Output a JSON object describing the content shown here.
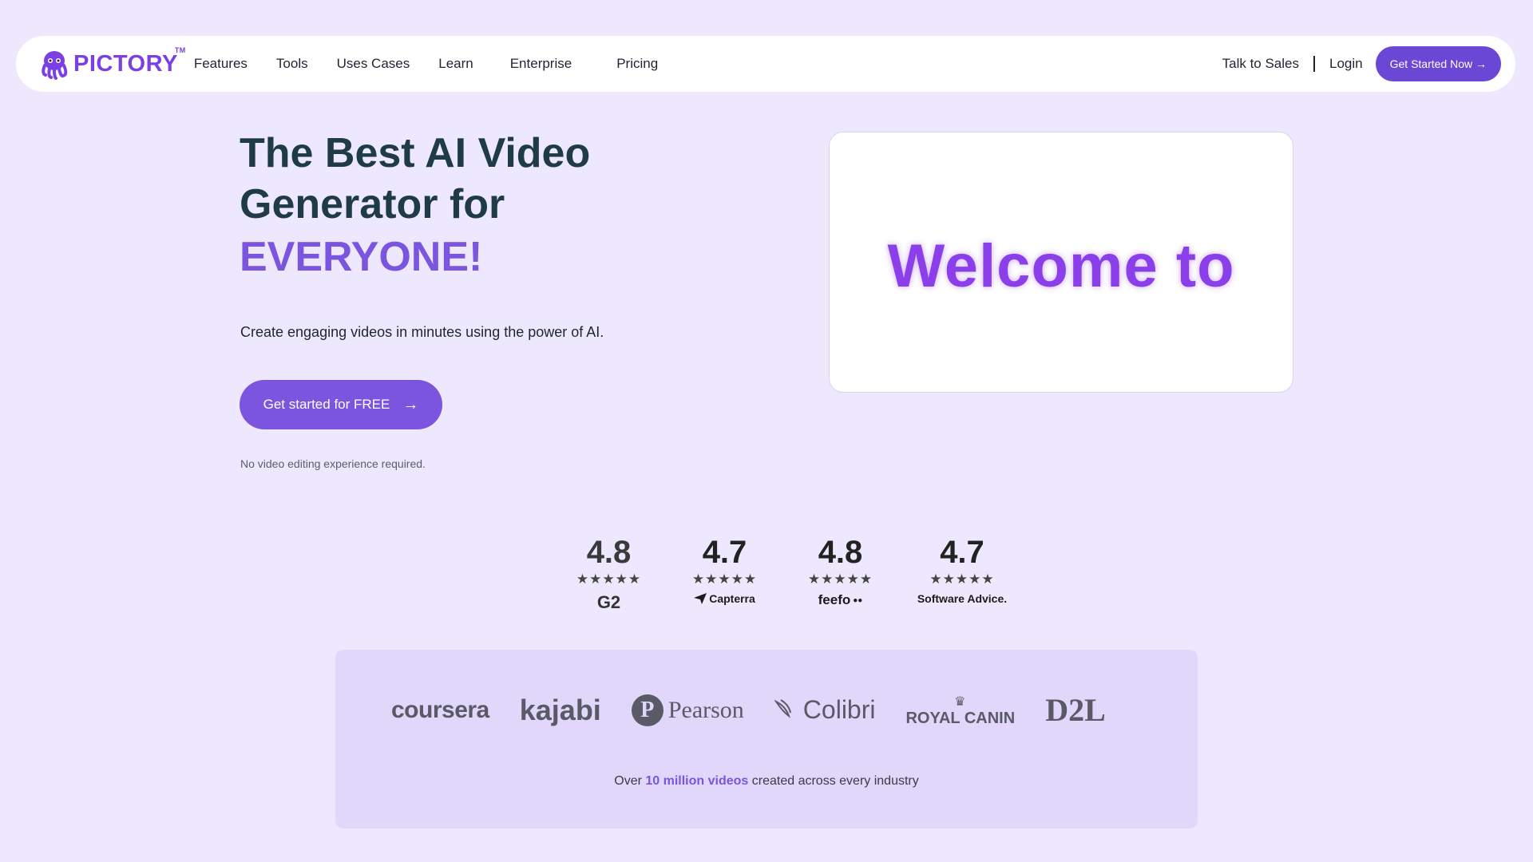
{
  "nav": {
    "logo_text": "PICTORY",
    "logo_tm": "TM",
    "links": [
      "Features",
      "Tools",
      "Uses Cases",
      "Learn",
      "Enterprise",
      "Pricing"
    ],
    "talk_to_sales": "Talk to Sales",
    "login": "Login",
    "cta": "Get Started Now →"
  },
  "hero": {
    "title_line1": "The Best AI Video",
    "title_line2": "Generator for",
    "title_accent": "EVERYONE!",
    "subtitle": "Create engaging videos in minutes using the power of AI.",
    "cta": "Get started for FREE",
    "cta_arrow": "→",
    "note": "No video editing experience required."
  },
  "video": {
    "text": "Welcome to"
  },
  "ratings": [
    {
      "score": "4.8",
      "stars": "★★★★★",
      "brand": "G2",
      "icon": "g2-logo-icon"
    },
    {
      "score": "4.7",
      "stars": "★★★★★",
      "brand": "Capterra",
      "icon": "capterra-logo-icon"
    },
    {
      "score": "4.8",
      "stars": "★★★★★",
      "brand": "feefo",
      "icon": "feefo-logo-icon"
    },
    {
      "score": "4.7",
      "stars": "★★★★★",
      "brand": "Software Advice.",
      "icon": "software-advice-logo-icon"
    }
  ],
  "clients": {
    "logos": [
      "coursera",
      "kajabi",
      "Pearson",
      "Colibri",
      "ROYAL CANIN",
      "D2L"
    ],
    "caption_before": "Over",
    "caption_highlight": "10 million videos",
    "caption_after": "created across every industry"
  },
  "colors": {
    "background": "#ede8fd",
    "accent": "#7b55e0",
    "brand_purple": "#7b3fe4",
    "nav_button": "#6b47d6"
  }
}
